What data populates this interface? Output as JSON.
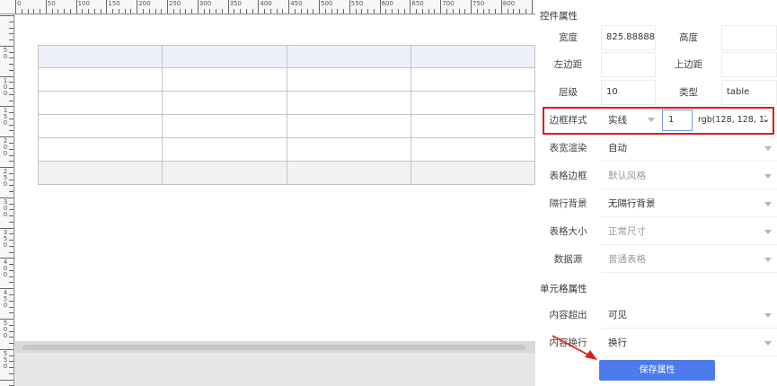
{
  "ruler": {
    "top_labels": [
      "0",
      "50",
      "100",
      "150",
      "200",
      "250",
      "300",
      "350",
      "400",
      "450",
      "500",
      "550",
      "600",
      "650",
      "700",
      "750",
      "800",
      "85"
    ],
    "left_labels": [
      "5 0",
      "1 0 0",
      "1 5 0",
      "2 0 0",
      "2 5 0",
      "3 0 0",
      "3 5 0",
      "4 0 0",
      "4 5 0",
      "5 0 0",
      "5 5 0",
      "6 0"
    ]
  },
  "panel": {
    "section_title": "控件属性",
    "width_label": "宽度",
    "width_value": "825.888888",
    "height_label": "高度",
    "height_value": "",
    "left_margin_label": "左边距",
    "left_margin_value": "",
    "top_margin_label": "上边距",
    "top_margin_value": "",
    "layer_label": "层级",
    "layer_value": "10",
    "type_label": "类型",
    "type_value": "table",
    "border_style_label": "边框样式",
    "border_style_value": "实线",
    "border_width_value": "1",
    "border_color_value": "rgb(128, 128, 12",
    "table_width_label": "表宽渲染",
    "table_width_value": "自动",
    "table_border_label": "表格边框",
    "table_border_value": "默认风格",
    "row_bg_label": "隔行背景",
    "row_bg_value": "无隔行背景",
    "table_size_label": "表格大小",
    "table_size_value": "正常尺寸",
    "datasource_label": "数据源",
    "datasource_value": "普通表格",
    "cell_section_title": "单元格属性",
    "overflow_label": "内容超出",
    "overflow_value": "可见",
    "wrap_label": "内容换行",
    "wrap_value": "换行",
    "save_label": "保存属性"
  },
  "colors": {
    "accent": "#4b7bec",
    "highlight": "#d91c1c",
    "table_header_bg": "#edf0fb",
    "table_alt_bg": "#f2f2f2"
  }
}
